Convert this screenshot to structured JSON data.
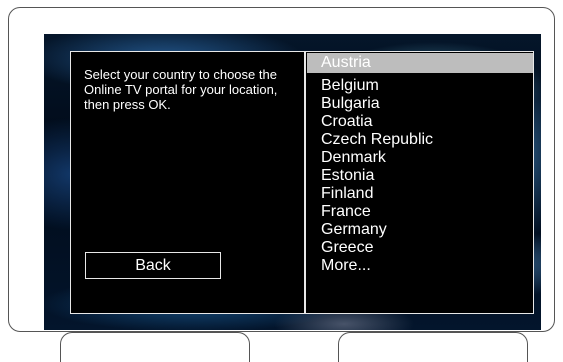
{
  "dialog": {
    "instruction": "Select your country to choose the Online TV portal for your location, then press OK.",
    "back_label": "Back"
  },
  "country_list": {
    "selected": "Austria",
    "items": [
      "Austria",
      "Belgium",
      "Bulgaria",
      "Croatia",
      "Czech Republic",
      "Denmark",
      "Estonia",
      "Finland",
      "France",
      "Germany",
      "Greece",
      "More..."
    ]
  },
  "colors": {
    "dialog_background": "#000000",
    "selection_highlight": "#bdbdbd",
    "text": "#ffffff"
  }
}
